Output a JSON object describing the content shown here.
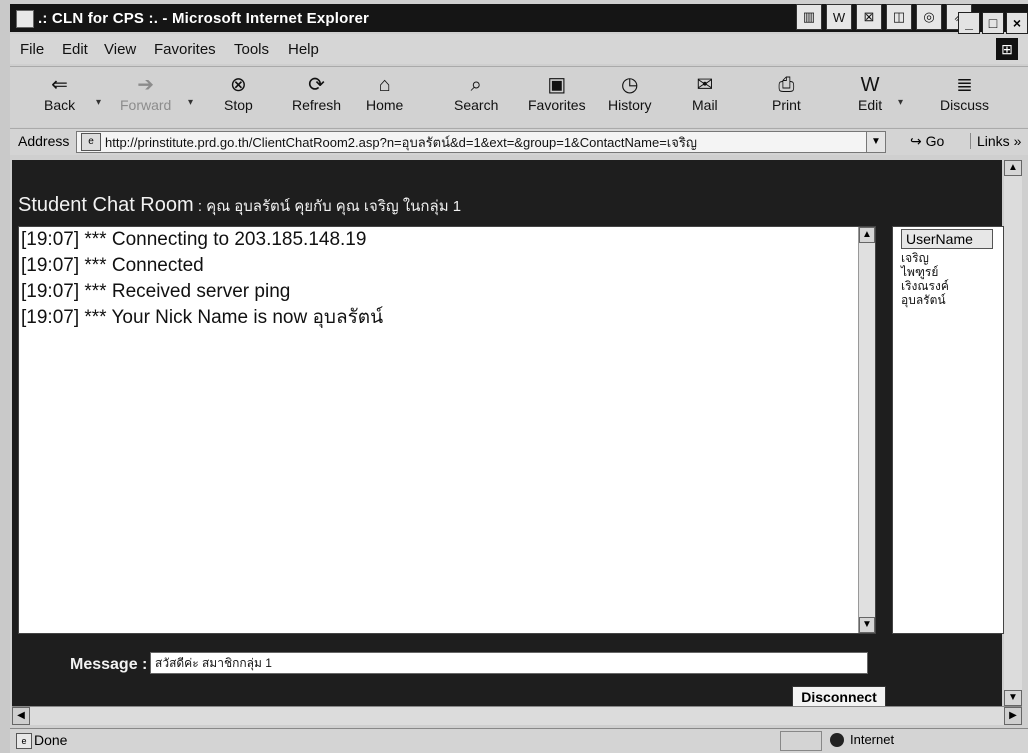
{
  "window": {
    "title": ".: CLN for CPS :. - Microsoft Internet Explorer",
    "badges": [
      "▥",
      "W",
      "⊠",
      "◫",
      "◎",
      "⇗"
    ],
    "controls": {
      "minimize": "_",
      "maximize": "□",
      "close": "×"
    }
  },
  "menu": [
    "File",
    "Edit",
    "View",
    "Favorites",
    "Tools",
    "Help"
  ],
  "toolbar": {
    "back": "Back",
    "forward": "Forward",
    "stop": "Stop",
    "refresh": "Refresh",
    "home": "Home",
    "search": "Search",
    "favorites": "Favorites",
    "history": "History",
    "mail": "Mail",
    "print": "Print",
    "edit": "Edit",
    "discuss": "Discuss"
  },
  "address": {
    "label": "Address",
    "url": "http://prinstitute.prd.go.th/ClientChatRoom2.asp?n=อุบลรัตน์&d=1&ext=&group=1&ContactName=เจริญ",
    "go": "Go",
    "links": "Links »"
  },
  "chat": {
    "title": "Student Chat Room",
    "subtitle": " : คุณ อุบลรัตน์ คุยกับ คุณ เจริญ ในกลุ่ม 1",
    "messages": [
      "[19:07] *** Connecting to 203.185.148.19",
      "[19:07] *** Connected",
      "[19:07] *** Received server ping",
      "[19:07] *** Your Nick Name is now อุบลรัตน์"
    ],
    "users_header": "UserName",
    "users": [
      "เจริญ",
      "ไพฑูรย์",
      "เริงณรงค์",
      "อุบลรัตน์"
    ],
    "message_label": "Message :",
    "message_value": "สวัสดีค่ะ สมาชิกกลุ่ม 1",
    "disconnect": "Disconnect"
  },
  "status": {
    "text": "Done",
    "zone": "Internet"
  }
}
